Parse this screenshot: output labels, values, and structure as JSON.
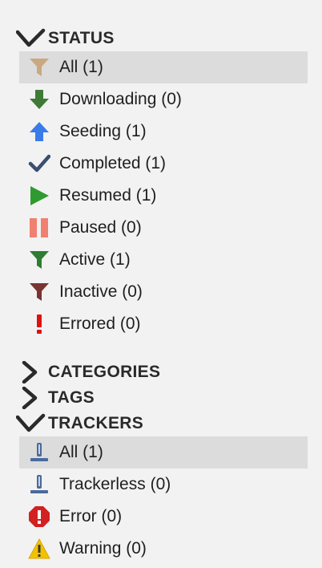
{
  "status": {
    "header": "STATUS",
    "items": [
      {
        "label": "All (1)",
        "icon": "filter-icon",
        "color": "#c9a882"
      },
      {
        "label": "Downloading (0)",
        "icon": "arrow-down-icon",
        "color": "#3f7a36"
      },
      {
        "label": "Seeding (1)",
        "icon": "arrow-up-icon",
        "color": "#3a7be8"
      },
      {
        "label": "Completed (1)",
        "icon": "checkmark-icon",
        "color": "#3b4e72"
      },
      {
        "label": "Resumed (1)",
        "icon": "play-icon",
        "color": "#2f9a2f"
      },
      {
        "label": "Paused (0)",
        "icon": "pause-icon",
        "color": "#f08070"
      },
      {
        "label": "Active (1)",
        "icon": "filter-icon",
        "color": "#2e7d32"
      },
      {
        "label": "Inactive (0)",
        "icon": "filter-icon",
        "color": "#7a3333"
      },
      {
        "label": "Errored (0)",
        "icon": "exclamation-icon",
        "color": "#e01010"
      }
    ]
  },
  "categories": {
    "header": "CATEGORIES"
  },
  "tags": {
    "header": "TAGS"
  },
  "trackers": {
    "header": "TRACKERS",
    "items": [
      {
        "label": "All (1)",
        "icon": "tracker-icon",
        "color": "#4a6a9a"
      },
      {
        "label": "Trackerless (0)",
        "icon": "tracker-icon",
        "color": "#4a6a9a"
      },
      {
        "label": "Error (0)",
        "icon": "error-octagon-icon",
        "color": "#d32020"
      },
      {
        "label": "Warning (0)",
        "icon": "warning-triangle-icon",
        "color": "#f2c200"
      }
    ]
  }
}
